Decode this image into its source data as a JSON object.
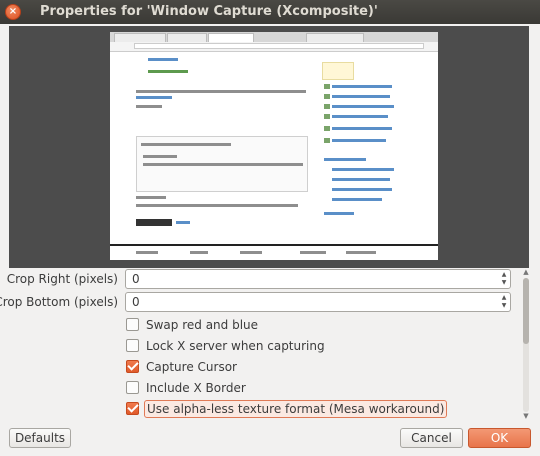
{
  "window": {
    "title": "Properties for 'Window Capture (Xcomposite)'"
  },
  "preview": {
    "browser_tabs": [
      "",
      "",
      "",
      ""
    ]
  },
  "properties": {
    "crop_right": {
      "label": "Crop Right (pixels)",
      "value": "0"
    },
    "crop_bottom": {
      "label": "Crop Bottom (pixels)",
      "value": "0"
    },
    "swap_red_blue": {
      "label": "Swap red and blue",
      "checked": false
    },
    "lock_x_server": {
      "label": "Lock X server when capturing",
      "checked": false
    },
    "capture_cursor": {
      "label": "Capture Cursor",
      "checked": true
    },
    "include_x_border": {
      "label": "Include X Border",
      "checked": false
    },
    "alpha_less": {
      "label": "Use alpha-less texture format (Mesa workaround)",
      "checked": true
    }
  },
  "buttons": {
    "defaults": "Defaults",
    "cancel": "Cancel",
    "ok": "OK"
  },
  "colors": {
    "accent": "#e8744a",
    "titlebar": "#3c3b37",
    "preview_bg": "#4c4c4c"
  },
  "icons": {
    "close": "close-icon",
    "spin": "spin-arrows-icon"
  }
}
